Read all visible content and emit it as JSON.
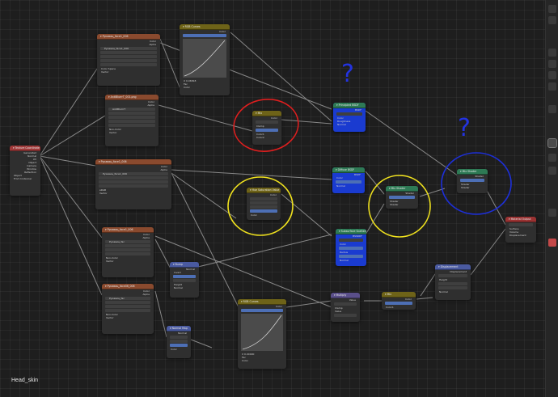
{
  "status": {
    "material_label": "Head_skin"
  },
  "rightbar": {
    "icons": [
      "tool-icon",
      "view-icon",
      "object-icon",
      "modifier-icon",
      "particles-icon",
      "physics-icon",
      "constraints-icon",
      "data-icon",
      "material-icon",
      "texture-icon",
      "scene-icon",
      "world-icon"
    ]
  },
  "nodes": {
    "texcoord": {
      "title": "Texture Coordinate",
      "rows": [
        "Generated",
        "Normal",
        "UV",
        "Object",
        "Camera",
        "Window",
        "Reflection"
      ],
      "object_label": "Object",
      "from_instancer": "From Instancer"
    },
    "img1": {
      "title": "Рукавиц_face1_006",
      "outputs": [
        "Color",
        "Alpha"
      ],
      "image": "Рукавиц_face1_006",
      "fields": [
        "Linear",
        "Flat",
        "Repeat",
        "Single Image"
      ],
      "colorspace_label": "Color Space",
      "colorspace": "Non-Color",
      "vector": "Vector"
    },
    "img2": {
      "title": "AntiBlurrrT_001.png",
      "outputs": [
        "Color",
        "Alpha"
      ],
      "image": "AntiBlurrrT",
      "fields": [
        "Linear",
        "Flat",
        "Repeat",
        "Single Image"
      ],
      "colorspace_label": "Color Space",
      "colorspace": "Non-Color",
      "vector": "Vector"
    },
    "img3": {
      "title": "Рукавиц_face1_006",
      "outputs": [
        "Color",
        "Alpha"
      ],
      "image": "Рукавиц_face1_006",
      "fields": [
        "Linear",
        "Flat",
        "Repeat",
        "Single Image"
      ],
      "colorspace_label": "Color Space",
      "colorspace": "sRGB",
      "vector": "Vector"
    },
    "img4": {
      "title": "Рукавиц_face1_006",
      "outputs": [
        "Color",
        "Alpha"
      ],
      "image": "Рукавиц_fac",
      "fields": [
        "Linear",
        "Flat",
        "Repeat",
        "Single Image"
      ],
      "colorspace_label": "Color Space",
      "colorspace": "Non-Color",
      "vector": "Vector"
    },
    "img5": {
      "title": "Рукавиц_face06_006",
      "outputs": [
        "Color",
        "Alpha"
      ],
      "image": "Рукавиц_fac",
      "fields": [
        "Linear",
        "Flat",
        "Repeat",
        "Single Image"
      ],
      "colorspace_label": "Color Space",
      "colorspace": "Non-Color",
      "vector": "Vector"
    },
    "rgbcurves1": {
      "title": "RGB Curves",
      "output": "Color",
      "tabs": [
        "Combine",
        "Fit View"
      ],
      "readout": [
        "X 0.06818",
        "Y 0.03909"
      ],
      "inputs": [
        "Fac",
        "Color"
      ]
    },
    "rgbcurves2": {
      "title": "RGB Curves",
      "output": "Color",
      "tabs": [
        "Combine",
        "Fit View"
      ],
      "readout": [
        "X 0.00000",
        "Y 0.00000"
      ],
      "inputs": [
        "Fac",
        "Color"
      ]
    },
    "mix": {
      "title": "Mix",
      "output": "Color",
      "fields": [
        "Mix",
        "Clamp"
      ],
      "inputs": [
        "Fac",
        "Color1",
        "Color2"
      ]
    },
    "hsv": {
      "title": "Hue Saturation Value",
      "output": "Color",
      "rows": [
        "Hue",
        "Saturation",
        "Value",
        "Fac",
        "Color"
      ],
      "values": [
        "0.500",
        "1.000",
        "1.000",
        "1.000",
        ""
      ]
    },
    "principled_sss": {
      "title": "Principled BSDF",
      "output": "BSDF",
      "method": "GGX",
      "rows": [
        "Color",
        "Roughness",
        "Normal"
      ]
    },
    "diffuse": {
      "title": "Diffuse BSDF",
      "output": "BSDF",
      "rows": [
        "Color",
        "Roughness",
        "Normal"
      ]
    },
    "sss": {
      "title": "Subsurface Scattering",
      "output": "BSSRDF",
      "method": "Christensen-Burley",
      "rows": [
        "Color",
        "Scale",
        "Radius",
        "Sharpness",
        "Normal"
      ]
    },
    "mixshader1": {
      "title": "Mix Shader",
      "output": "Shader",
      "rows": [
        "Fac",
        "Shader",
        "Shader"
      ],
      "fac": "0.478"
    },
    "mixshader2": {
      "title": "Mix Shader",
      "output": "Shader",
      "rows": [
        "Fac",
        "Shader",
        "Shader"
      ],
      "fac": "0.800"
    },
    "output": {
      "title": "Material Output",
      "target": "All",
      "rows": [
        "Surface",
        "Volume",
        "Displacement"
      ]
    },
    "bump": {
      "title": "Bump",
      "output": "Normal",
      "rows": [
        "Invert",
        "Strength",
        "Distance",
        "Height",
        "Normal"
      ]
    },
    "normalmap": {
      "title": "Normal Map",
      "output": "Normal",
      "fields": [
        "Tangent Space",
        "UVMap"
      ],
      "rows": [
        "Strength",
        "Color"
      ]
    },
    "displacement": {
      "title": "Displacement",
      "output": "Displacement",
      "space": "Object Space",
      "rows": [
        "Height",
        "Midlevel",
        "Scale",
        "Normal"
      ]
    },
    "math": {
      "title": "Multiply",
      "output": "Value",
      "fields": [
        "Multiply",
        "Clamp"
      ],
      "rows": [
        "Value",
        "Value"
      ]
    },
    "colorramp": {
      "title": "Mix",
      "output": "Color",
      "rows": [
        "Fac",
        "Color1",
        "Color2"
      ]
    }
  },
  "annotations": {
    "question_marks": [
      "?",
      "?"
    ]
  }
}
